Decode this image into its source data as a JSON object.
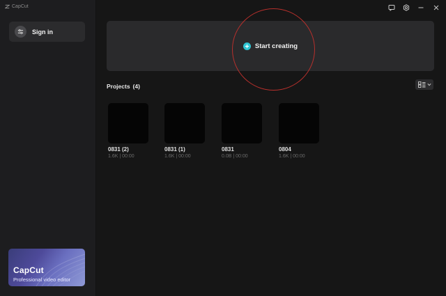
{
  "app": {
    "title": "CapCut"
  },
  "sidebar": {
    "signin_label": "Sign in",
    "promo": {
      "brand": "CapCut",
      "tagline": "Professional video editor"
    }
  },
  "titlebar": {
    "icons": [
      "feedback-icon",
      "settings-icon",
      "minimize-icon",
      "close-icon"
    ]
  },
  "main": {
    "start_label": "Start creating",
    "projects_label": "Projects",
    "projects_count": "(4)",
    "projects": [
      {
        "name": "0831 (2)",
        "meta": "1.6K | 00:00"
      },
      {
        "name": "0831 (1)",
        "meta": "1.6K | 00:00"
      },
      {
        "name": "0831",
        "meta": "0.0B | 00:00"
      },
      {
        "name": "0804",
        "meta": "1.6K | 00:00"
      }
    ]
  },
  "colors": {
    "accent": "#2ec5d3",
    "annotation_ring": "#b8302c",
    "background": "#161616",
    "sidebar": "#1d1d1f",
    "panel": "#2a2a2c"
  }
}
